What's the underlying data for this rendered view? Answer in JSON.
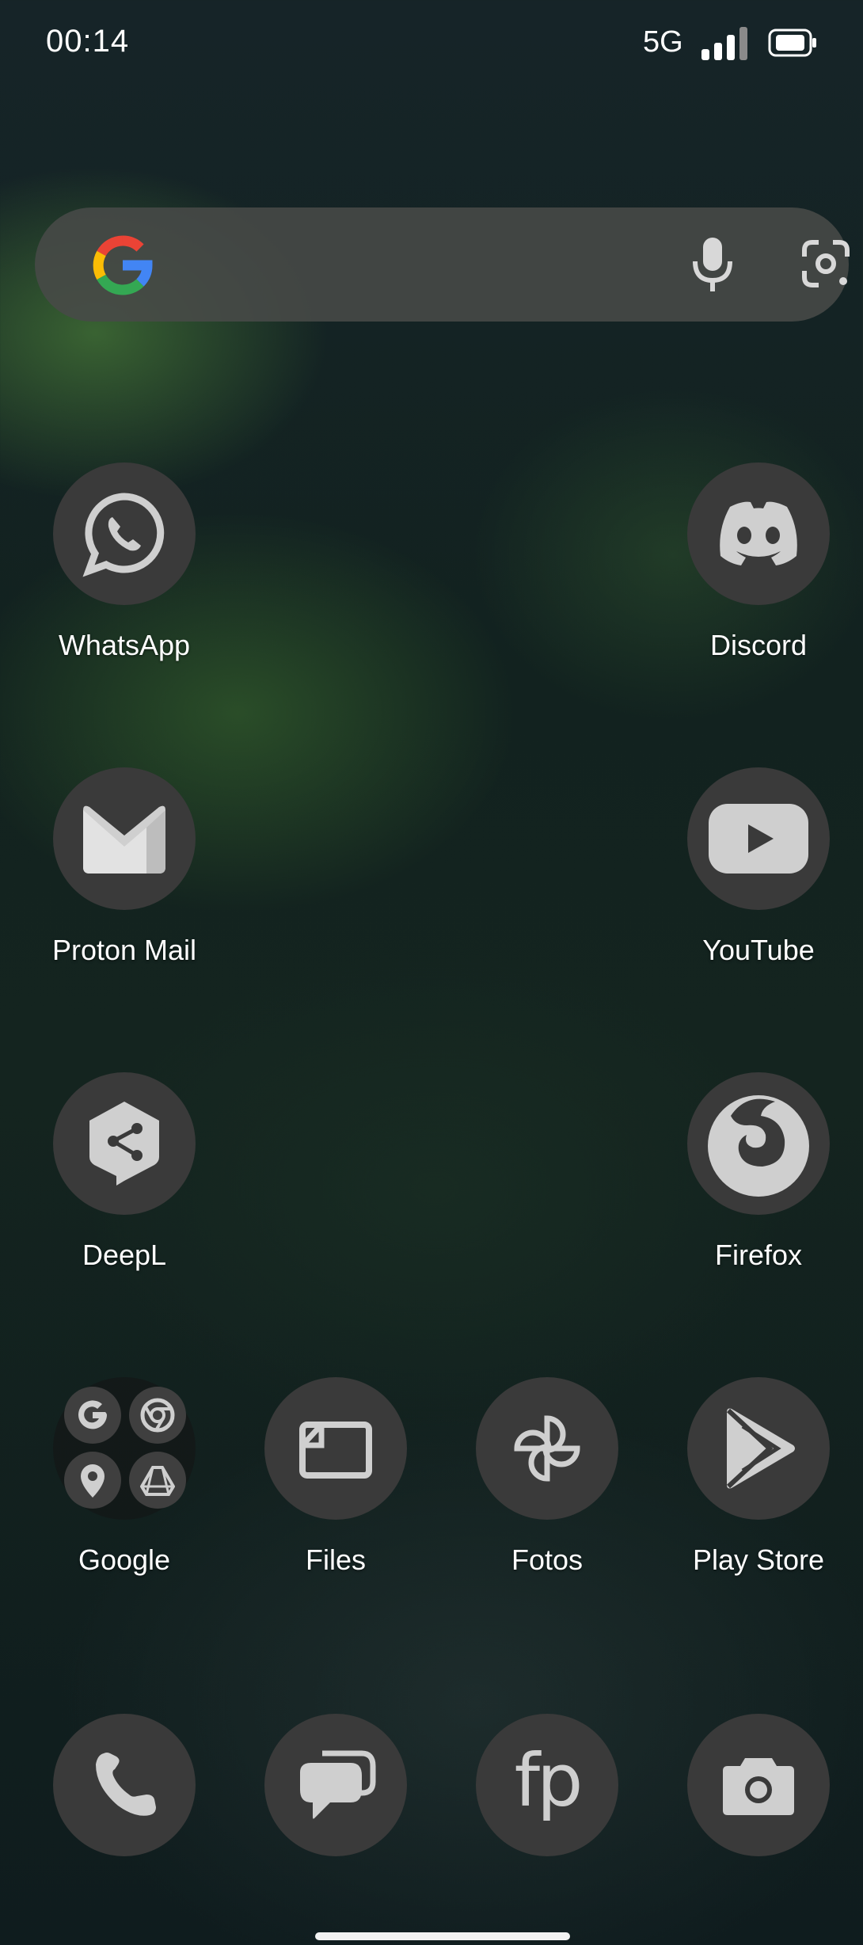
{
  "status_bar": {
    "time": "00:14",
    "network": "5G"
  },
  "search": {
    "icon": "google-g-icon"
  },
  "apps": {
    "whatsapp": "WhatsApp",
    "discord": "Discord",
    "proton_mail": "Proton Mail",
    "youtube": "YouTube",
    "deepl": "DeepL",
    "firefox": "Firefox",
    "google": "Google",
    "files": "Files",
    "fotos": "Fotos",
    "play_store": "Play Store"
  },
  "dock": {
    "fp_logo_text": "fp"
  },
  "colors": {
    "icon_bg": "#3a3a3a",
    "icon_fg": "#c9c9c9",
    "search_bg": "#484a48"
  }
}
